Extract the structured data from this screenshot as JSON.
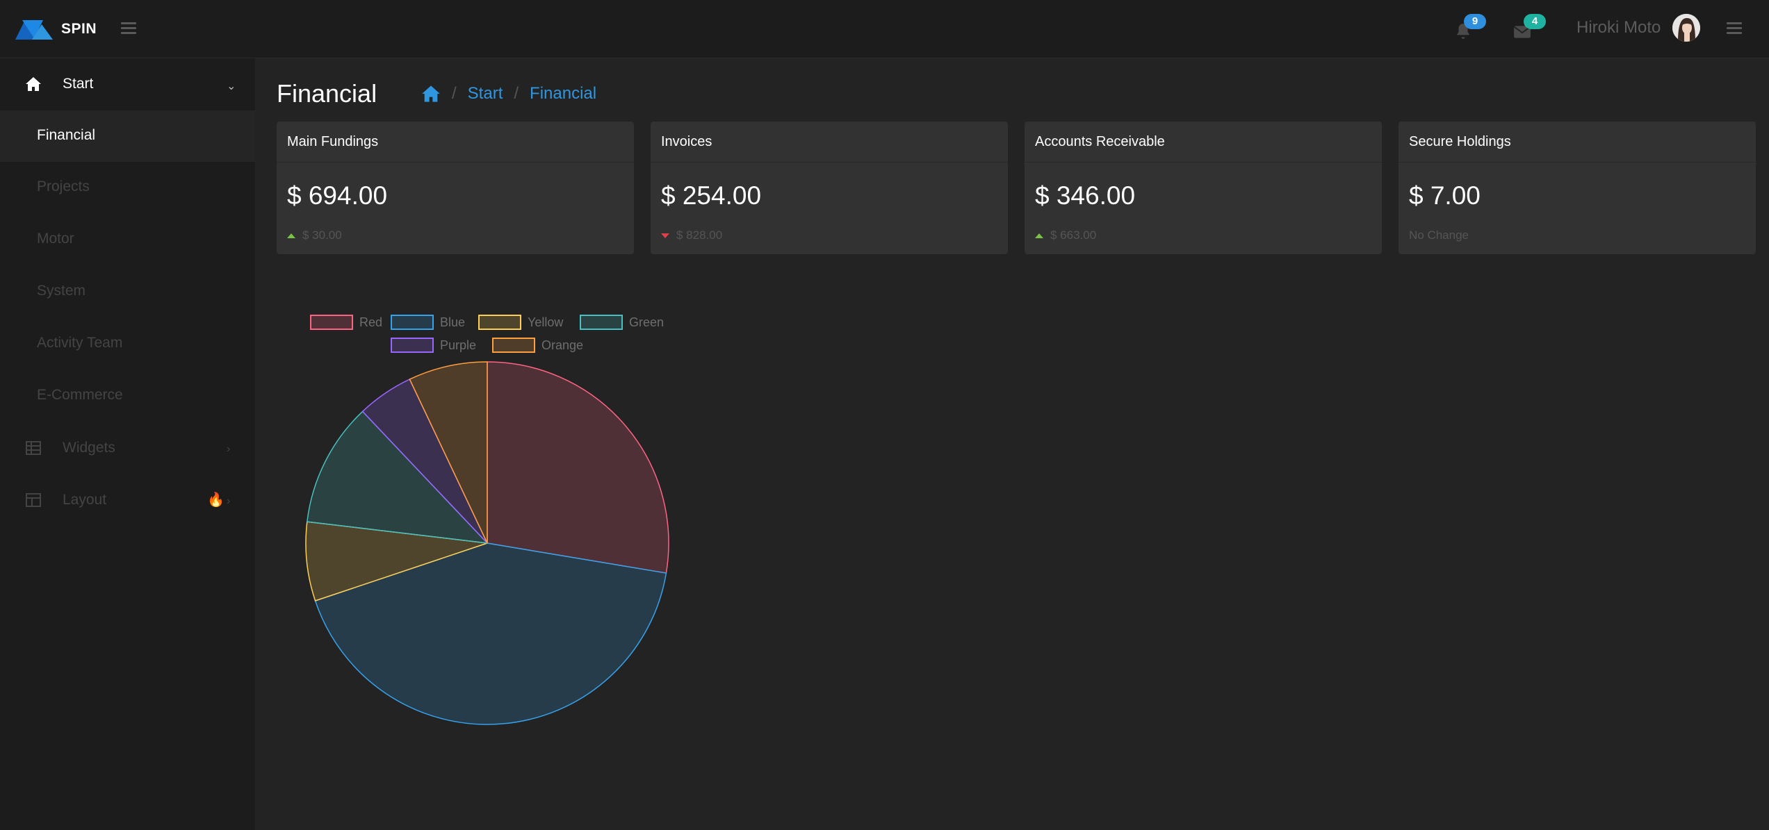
{
  "brand": {
    "name": "SPIN"
  },
  "header": {
    "notifications_count": "9",
    "messages_count": "4",
    "user_name": "Hiroki Moto",
    "colors": {
      "notif_badge": "#2f8fdc",
      "msg_badge": "#20b2a0"
    }
  },
  "sidebar": {
    "start": {
      "label": "Start"
    },
    "items": [
      {
        "label": "Financial",
        "active": true
      },
      {
        "label": "Projects"
      },
      {
        "label": "Motor"
      },
      {
        "label": "System"
      },
      {
        "label": "Activity Team"
      },
      {
        "label": "E-Commerce"
      }
    ],
    "widgets": {
      "label": "Widgets"
    },
    "layout": {
      "label": "Layout"
    }
  },
  "page": {
    "title": "Financial",
    "breadcrumb": [
      "Start",
      "Financial"
    ]
  },
  "cards": [
    {
      "title": "Main Fundings",
      "value": "$ 694.00",
      "trend": "up",
      "change": "$ 30.00"
    },
    {
      "title": "Invoices",
      "value": "$ 254.00",
      "trend": "down",
      "change": "$ 828.00"
    },
    {
      "title": "Accounts Receivable",
      "value": "$ 346.00",
      "trend": "up",
      "change": "$ 663.00"
    },
    {
      "title": "Secure Holdings",
      "value": "$ 7.00",
      "trend": "none",
      "change": "No Change"
    }
  ],
  "chart_data": {
    "type": "pie",
    "title": "",
    "legend_position": "top",
    "categories": [
      "Red",
      "Blue",
      "Yellow",
      "Green",
      "Purple",
      "Orange"
    ],
    "values": [
      27.5,
      42,
      7,
      11,
      5,
      7
    ],
    "colors": [
      "#ff6384",
      "#36a2eb",
      "#ffce56",
      "#4bc0c0",
      "#9966ff",
      "#ff9f40"
    ]
  }
}
